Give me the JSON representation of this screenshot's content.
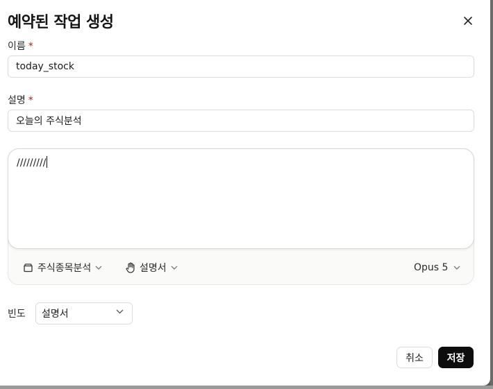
{
  "dialog": {
    "title": "예약된 작업 생성"
  },
  "fields": {
    "name": {
      "label": "이름",
      "required_mark": "*",
      "value": "today_stock"
    },
    "description": {
      "label": "설명",
      "required_mark": "*",
      "value": "오늘의 주식분석"
    }
  },
  "composer": {
    "text": "/////////",
    "project_label": "주식종목분석",
    "style_label": "설명서",
    "model_label": "Opus 5"
  },
  "frequency": {
    "label": "빈도",
    "selected": "설명서"
  },
  "actions": {
    "cancel_label": "취소",
    "save_label": "저장"
  },
  "icons": {
    "close": "close-icon",
    "project": "folder-icon",
    "style": "hand-icon",
    "chevron": "chevron-down-icon"
  }
}
